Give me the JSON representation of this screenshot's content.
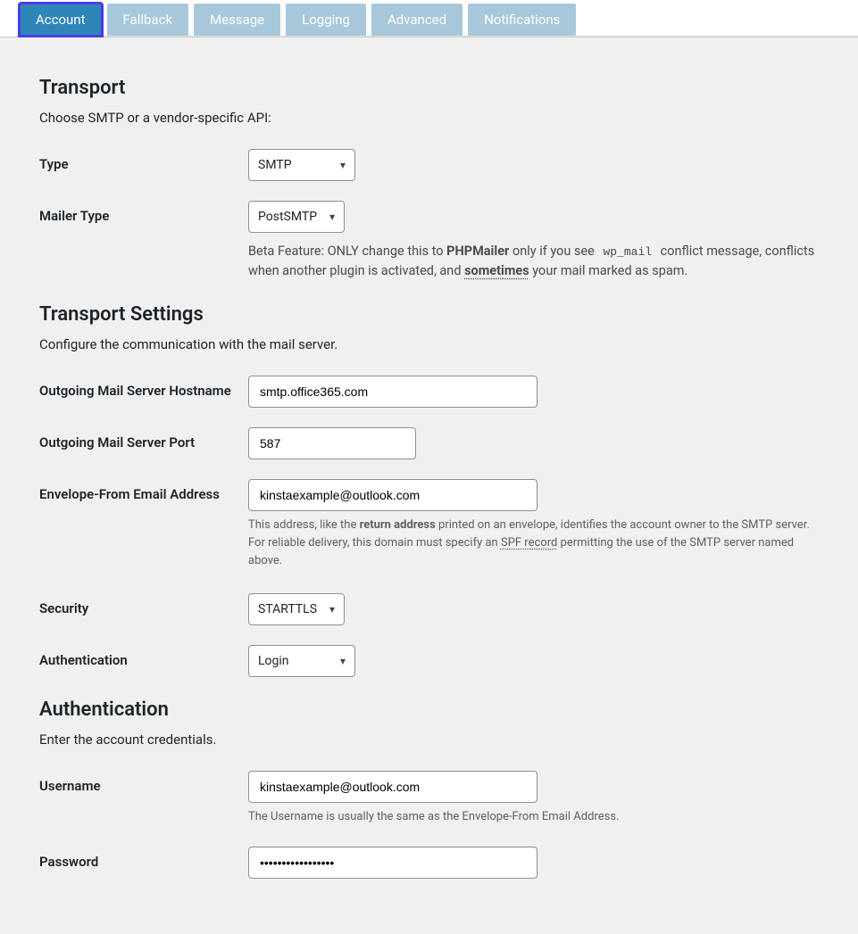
{
  "tabs": [
    "Account",
    "Fallback",
    "Message",
    "Logging",
    "Advanced",
    "Notifications"
  ],
  "activeTab": "Account",
  "transport": {
    "heading": "Transport",
    "desc": "Choose SMTP or a vendor-specific API:",
    "type_label": "Type",
    "type_value": "SMTP",
    "mailer_label": "Mailer Type",
    "mailer_value": "PostSMTP",
    "mailer_help_prefix": "Beta Feature: ONLY change this to ",
    "mailer_help_bold1": "PHPMailer",
    "mailer_help_mid1": " only if you see ",
    "mailer_help_code": "wp_mail",
    "mailer_help_mid2": " conflict message, conflicts when another plugin is activated, and ",
    "mailer_help_bold2": "sometimes",
    "mailer_help_suffix": " your mail marked as spam."
  },
  "settings": {
    "heading": "Transport Settings",
    "desc": "Configure the communication with the mail server.",
    "hostname_label": "Outgoing Mail Server Hostname",
    "hostname_value": "smtp.office365.com",
    "port_label": "Outgoing Mail Server Port",
    "port_value": "587",
    "envelope_label": "Envelope-From Email Address",
    "envelope_value": "kinstaexample@outlook.com",
    "envelope_help_prefix": "This address, like the ",
    "envelope_help_bold": "return address",
    "envelope_help_mid": " printed on an envelope, identifies the account owner to the SMTP server. For reliable delivery, this domain must specify an ",
    "envelope_help_link": "SPF record",
    "envelope_help_suffix": " permitting the use of the SMTP server named above.",
    "security_label": "Security",
    "security_value": "STARTTLS",
    "auth_label": "Authentication",
    "auth_value": "Login"
  },
  "auth": {
    "heading": "Authentication",
    "desc": "Enter the account credentials.",
    "username_label": "Username",
    "username_value": "kinstaexample@outlook.com",
    "username_help": "The Username is usually the same as the Envelope-From Email Address.",
    "password_label": "Password",
    "password_value": "•••••••••••••••••"
  }
}
